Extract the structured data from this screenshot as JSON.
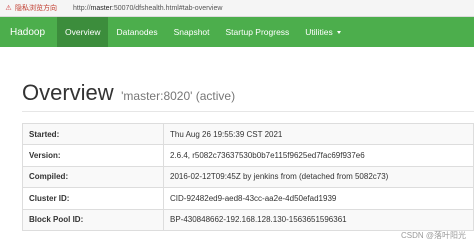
{
  "browser": {
    "warning": "隐私浏览方向",
    "url_prefix": "http://",
    "url_host": "master",
    "url_rest": ":50070/dfshealth.html#tab-overview"
  },
  "navbar": {
    "brand": "Hadoop",
    "items": [
      {
        "label": "Overview",
        "active": true
      },
      {
        "label": "Datanodes"
      },
      {
        "label": "Snapshot"
      },
      {
        "label": "Startup Progress"
      },
      {
        "label": "Utilities"
      }
    ],
    "color": "#4cae4c",
    "active_color": "#3c8d3c"
  },
  "header": {
    "title": "Overview",
    "subtitle": "'master:8020' (active)"
  },
  "info": [
    {
      "key": "Started:",
      "value": "Thu Aug 26 19:55:39 CST 2021"
    },
    {
      "key": "Version:",
      "value": "2.6.4, r5082c73637530b0b7e115f9625ed7fac69f937e6"
    },
    {
      "key": "Compiled:",
      "value": "2016-02-12T09:45Z by jenkins from (detached from 5082c73)"
    },
    {
      "key": "Cluster ID:",
      "value": "CID-92482ed9-aed8-43cc-aa2e-4d50efad1939"
    },
    {
      "key": "Block Pool ID:",
      "value": "BP-430848662-192.168.128.130-1563651596361"
    }
  ],
  "watermark": "CSDN @落叶阳光"
}
